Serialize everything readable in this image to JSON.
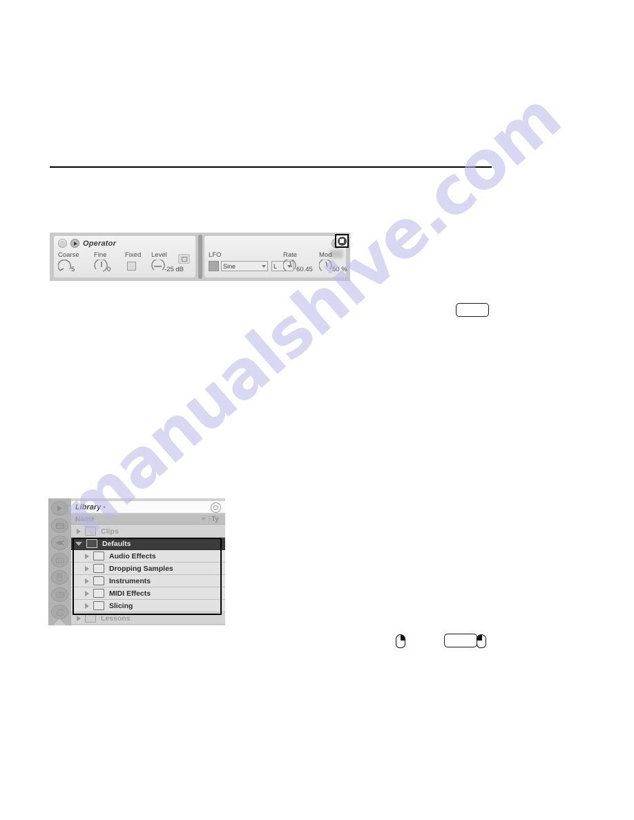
{
  "page": {
    "watermark": "manualshive.com"
  },
  "operator_device": {
    "title": "Operator",
    "power_icon": "power-circle-icon",
    "fold_icon": "fold-triangle-icon",
    "left_panel": {
      "controls": [
        {
          "label": "Coarse",
          "value": "5",
          "type": "knob"
        },
        {
          "label": "Fine",
          "value": "0",
          "type": "knob"
        },
        {
          "label": "Fixed",
          "value": "",
          "type": "checkbox"
        },
        {
          "label": "Level",
          "value": "-25 dB",
          "type": "knob"
        }
      ]
    },
    "right_panel": {
      "lfo_label": "LFO",
      "waveform": "Sine",
      "destination": "L",
      "controls": [
        {
          "label": "Rate",
          "value": "60.45",
          "type": "knob"
        },
        {
          "label": "Mod",
          "value": "50 %",
          "type": "knob"
        }
      ],
      "hotswap_icon": "hotswap-circle-icon",
      "save_icon": "save-disk-icon"
    }
  },
  "browser": {
    "title": "Library",
    "title_caret": "▾",
    "search_icon": "search-target-icon",
    "columns": {
      "name": "Name",
      "type": "Ty"
    },
    "rows": [
      {
        "label": "Clips",
        "indent": 0,
        "state": "collapsed",
        "style": "plain",
        "folder": "closed"
      },
      {
        "label": "Defaults",
        "indent": 0,
        "state": "expanded",
        "style": "selected",
        "folder": "open"
      },
      {
        "label": "Audio Effects",
        "indent": 1,
        "state": "collapsed",
        "style": "inbox",
        "folder": "closed"
      },
      {
        "label": "Dropping Samples",
        "indent": 1,
        "state": "collapsed",
        "style": "inbox",
        "folder": "closed"
      },
      {
        "label": "Instruments",
        "indent": 1,
        "state": "collapsed",
        "style": "inbox",
        "folder": "closed"
      },
      {
        "label": "MIDI Effects",
        "indent": 1,
        "state": "collapsed",
        "style": "inbox",
        "folder": "closed"
      },
      {
        "label": "Slicing",
        "indent": 1,
        "state": "collapsed",
        "style": "inbox",
        "folder": "closed"
      },
      {
        "label": "Lessons",
        "indent": 0,
        "state": "collapsed",
        "style": "plain",
        "folder": "closed"
      }
    ],
    "sidebar_icons": [
      "play-triangle-icon",
      "clip-rectangle-icon",
      "plug-audio-effects-icon",
      "midi-effects-icon",
      "instruments-icon",
      "samples-camera-icon",
      "packs-refresh-icon"
    ]
  },
  "margin_icons": {
    "key_badge_1": "key-badge",
    "key_badge_2": "key-badge",
    "mouse_right": "mouse-right-click-icon",
    "mouse_left": "mouse-left-click-icon"
  }
}
